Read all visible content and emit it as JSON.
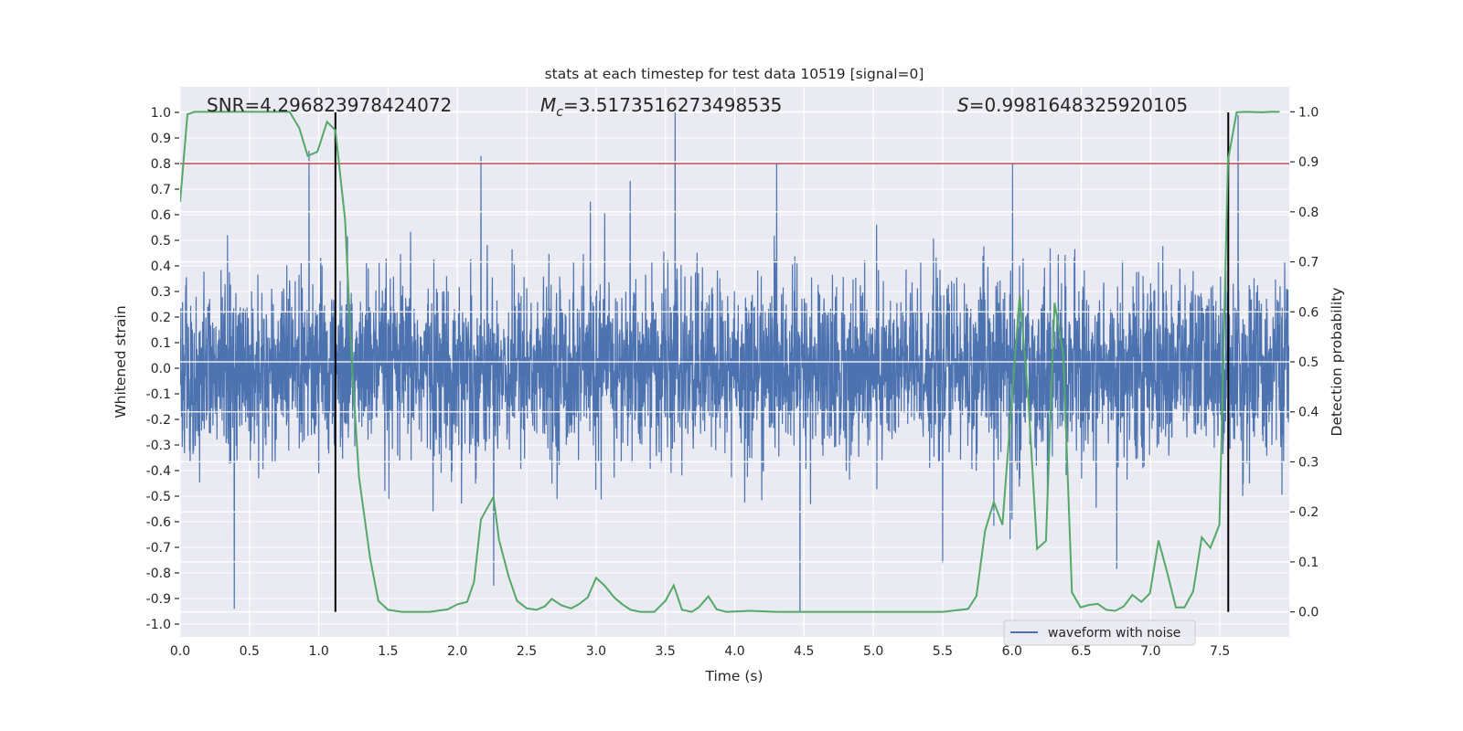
{
  "chart_data": {
    "type": "line",
    "title": "stats at each timestep for test data 10519 [signal=0]",
    "xlabel": "Time (s)",
    "ylabel": "Whitened strain",
    "ylabel_right": "Detection probability",
    "xlim": [
      0,
      8
    ],
    "ylim": [
      -1.05,
      1.1
    ],
    "ylim_right": [
      -0.05,
      1.05
    ],
    "grid": true,
    "legend_placement": "bottom-right",
    "x_ticks": [
      "0.0",
      "0.5",
      "1.0",
      "1.5",
      "2.0",
      "2.5",
      "3.0",
      "3.5",
      "4.0",
      "4.5",
      "5.0",
      "5.5",
      "6.0",
      "6.5",
      "7.0",
      "7.5"
    ],
    "y_ticks": [
      "-1.0",
      "-0.9",
      "-0.8",
      "-0.7",
      "-0.6",
      "-0.5",
      "-0.4",
      "-0.3",
      "-0.2",
      "-0.1",
      "0.0",
      "0.1",
      "0.2",
      "0.3",
      "0.4",
      "0.5",
      "0.6",
      "0.7",
      "0.8",
      "0.9",
      "1.0"
    ],
    "y_ticks_right": [
      "0.0",
      "0.1",
      "0.2",
      "0.3",
      "0.4",
      "0.5",
      "0.6",
      "0.7",
      "0.8",
      "0.9",
      "1.0"
    ],
    "annotations": {
      "snr": "SNR=4.296823978424072",
      "mc_prefix": "M",
      "mc_sub": "c",
      "mc_value": "=3.5173516273498535",
      "s_prefix": "S",
      "s_value": "=0.9981648325920105"
    },
    "threshold": {
      "axis": "left",
      "value": 0.8,
      "color": "#c44e52"
    },
    "vertical_lines": {
      "x": [
        1.12,
        7.56
      ],
      "color": "#000000"
    },
    "series": [
      {
        "name": "waveform with noise",
        "axis": "left",
        "color": "#4c72b0",
        "kind": "noise",
        "typical_amplitude": 0.4,
        "extrema": [
          [
            0.39,
            -0.94
          ],
          [
            0.93,
            0.85
          ],
          [
            2.17,
            0.83
          ],
          [
            3.57,
            1.0
          ],
          [
            4.47,
            -0.95
          ],
          [
            7.63,
            0.99
          ]
        ]
      },
      {
        "axis": "right",
        "color": "#55a868",
        "points": [
          [
            0,
            0.82
          ],
          [
            0.053,
            0.995
          ],
          [
            0.105,
            1.0
          ],
          [
            0.5,
            1.0
          ],
          [
            0.79,
            1.0
          ],
          [
            0.86,
            0.967
          ],
          [
            0.92,
            0.912
          ],
          [
            0.99,
            0.92
          ],
          [
            1.06,
            0.98
          ],
          [
            1.12,
            0.963
          ],
          [
            1.19,
            0.784
          ],
          [
            1.24,
            0.49
          ],
          [
            1.29,
            0.27
          ],
          [
            1.37,
            0.108
          ],
          [
            1.43,
            0.022
          ],
          [
            1.5,
            0.004
          ],
          [
            1.6,
            0.0
          ],
          [
            1.8,
            0.0
          ],
          [
            1.93,
            0.005
          ],
          [
            2.0,
            0.015
          ],
          [
            2.07,
            0.02
          ],
          [
            2.12,
            0.06
          ],
          [
            2.17,
            0.185
          ],
          [
            2.26,
            0.23
          ],
          [
            2.3,
            0.144
          ],
          [
            2.37,
            0.07
          ],
          [
            2.43,
            0.022
          ],
          [
            2.5,
            0.007
          ],
          [
            2.57,
            0.004
          ],
          [
            2.63,
            0.011
          ],
          [
            2.68,
            0.026
          ],
          [
            2.75,
            0.013
          ],
          [
            2.82,
            0.007
          ],
          [
            2.88,
            0.016
          ],
          [
            2.94,
            0.029
          ],
          [
            3.0,
            0.068
          ],
          [
            3.06,
            0.053
          ],
          [
            3.13,
            0.029
          ],
          [
            3.19,
            0.015
          ],
          [
            3.25,
            0.004
          ],
          [
            3.32,
            0.0
          ],
          [
            3.42,
            0.0
          ],
          [
            3.5,
            0.022
          ],
          [
            3.56,
            0.053
          ],
          [
            3.62,
            0.004
          ],
          [
            3.69,
            0.0
          ],
          [
            3.74,
            0.009
          ],
          [
            3.81,
            0.031
          ],
          [
            3.87,
            0.005
          ],
          [
            3.94,
            0.0
          ],
          [
            4.11,
            0.002
          ],
          [
            4.3,
            0.0
          ],
          [
            4.97,
            0.0
          ],
          [
            5.5,
            0.0
          ],
          [
            5.63,
            0.004
          ],
          [
            5.684,
            0.006
          ],
          [
            5.744,
            0.032
          ],
          [
            5.806,
            0.162
          ],
          [
            5.869,
            0.22
          ],
          [
            5.931,
            0.174
          ],
          [
            6.056,
            0.633
          ],
          [
            6.118,
            0.426
          ],
          [
            6.181,
            0.126
          ],
          [
            6.245,
            0.142
          ],
          [
            6.307,
            0.618
          ],
          [
            6.37,
            0.514
          ],
          [
            6.432,
            0.039
          ],
          [
            6.494,
            0.009
          ],
          [
            6.557,
            0.014
          ],
          [
            6.619,
            0.016
          ],
          [
            6.681,
            0.004
          ],
          [
            6.744,
            0.002
          ],
          [
            6.806,
            0.011
          ],
          [
            6.868,
            0.034
          ],
          [
            6.933,
            0.02
          ],
          [
            6.995,
            0.037
          ],
          [
            7.057,
            0.143
          ],
          [
            7.12,
            0.078
          ],
          [
            7.182,
            0.009
          ],
          [
            7.244,
            0.009
          ],
          [
            7.307,
            0.041
          ],
          [
            7.369,
            0.149
          ],
          [
            7.431,
            0.128
          ],
          [
            7.496,
            0.174
          ],
          [
            7.558,
            0.903
          ],
          [
            7.62,
            0.999
          ],
          [
            7.683,
            1.0
          ],
          [
            7.807,
            0.999
          ],
          [
            7.865,
            1.0
          ],
          [
            7.93,
            1.0
          ]
        ]
      }
    ]
  }
}
